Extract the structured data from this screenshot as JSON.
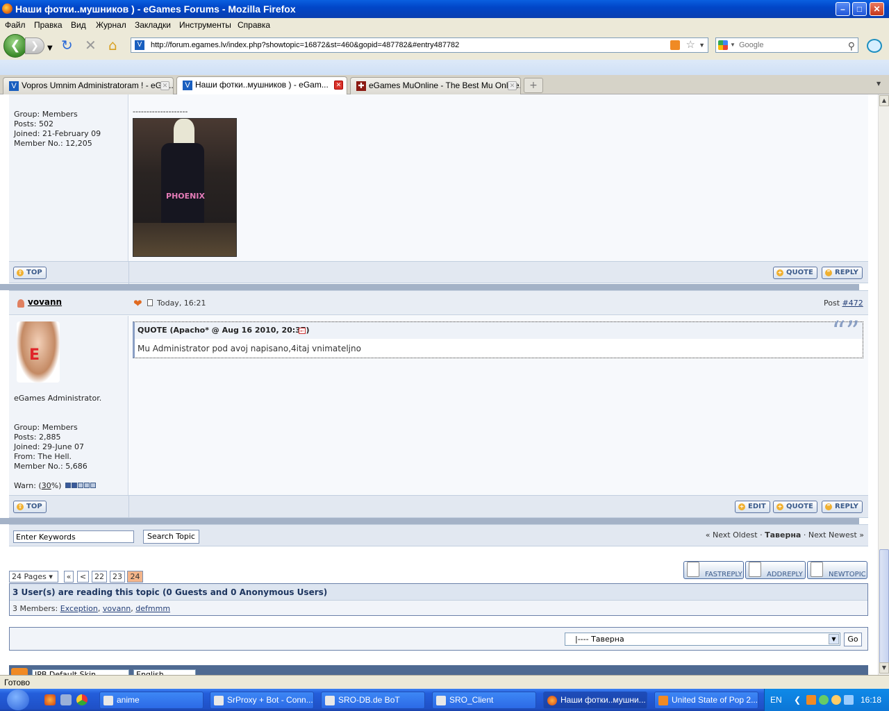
{
  "window": {
    "title": "Наши фотки..мушников ) - eGames Forums - Mozilla Firefox"
  },
  "menu": [
    "Файл",
    "Правка",
    "Вид",
    "Журнал",
    "Закладки",
    "Инструменты",
    "Справка"
  ],
  "nav": {
    "url": "http://forum.egames.lv/index.php?showtopic=16872&st=460&gopid=487782&#entry487782",
    "search_placeholder": "Google"
  },
  "tabs": [
    {
      "label": "Vopros Umnim Administratoram ! - eGa..."
    },
    {
      "label": "Наши фотки..мушников ) - eGam..."
    },
    {
      "label": "eGames MuOnline - The Best Mu Online..."
    }
  ],
  "post1": {
    "group": "Group: Members",
    "posts": "Posts: 502",
    "joined": "Joined: 21-February 09",
    "member_no": "Member No.: 12,205",
    "sig_line": "--------------------",
    "photo_text": "PHOENIX",
    "top_label": "TOP",
    "quote_label": "QUOTE",
    "reply_label": "REPLY"
  },
  "post2": {
    "username": "vovann",
    "date": "Today, 16:21",
    "post_label": "Post ",
    "post_number": "#472",
    "quote_header": "QUOTE (Apacho* @ Aug 16 2010, 20:37)",
    "quote_text": "Mu Administrator pod avoj napisano,4itaj vnimateljno",
    "title": "eGames Administrator.",
    "group": "Group: Members",
    "posts": "Posts: 2,885",
    "joined": "Joined: 29-June 07",
    "from": "From: The Hell.",
    "member_no": "Member No.: 5,686",
    "warn_prefix": "Warn: (",
    "warn_value": "30",
    "warn_suffix": "%)",
    "warn_level": 0.3,
    "top_label": "TOP",
    "edit_label": "EDIT",
    "quote_label": "QUOTE",
    "reply_label": "REPLY"
  },
  "searchbar": {
    "keywords_value": "Enter Keywords",
    "search_button": "Search Topic",
    "next_oldest": "« Next Oldest",
    "dot1": " · ",
    "forum_name": "Таверна",
    "dot2": " · ",
    "next_newest": "Next Newest »"
  },
  "pagination": {
    "pages_label": "24 Pages ▾",
    "first": "«",
    "prev": "<",
    "p22": "22",
    "p23": "23",
    "p24": "24"
  },
  "actions": {
    "fastreply": "FASTREPLY",
    "addreply": "ADDREPLY",
    "newtopic": "NEWTOPIC"
  },
  "readers": {
    "header": "3 User(s) are reading this topic (0 Guests and 0 Anonymous Users)",
    "members_label": "3 Members: ",
    "m1": "Exception",
    "m2": "vovann",
    "m3": "defmmm"
  },
  "jump": {
    "selected": "|---- Таверна",
    "go": "Go"
  },
  "footer": {
    "skin": "IPB Default Skin",
    "lang": "English"
  },
  "status": {
    "text": "Готово"
  },
  "taskbar": {
    "items": [
      "anime",
      "SrProxy + Bot - Conn...",
      "SRO-DB.de BoT",
      "SRO_Client",
      "Наши фотки..мушни...",
      "United State of Pop 2..."
    ],
    "lang": "EN",
    "clock": "16:18"
  },
  "colors": {
    "accent": "#0a3fb0",
    "forum_bar": "#e2e8f1",
    "separator": "#a4b2c7",
    "active_page": "#f4b58a"
  }
}
